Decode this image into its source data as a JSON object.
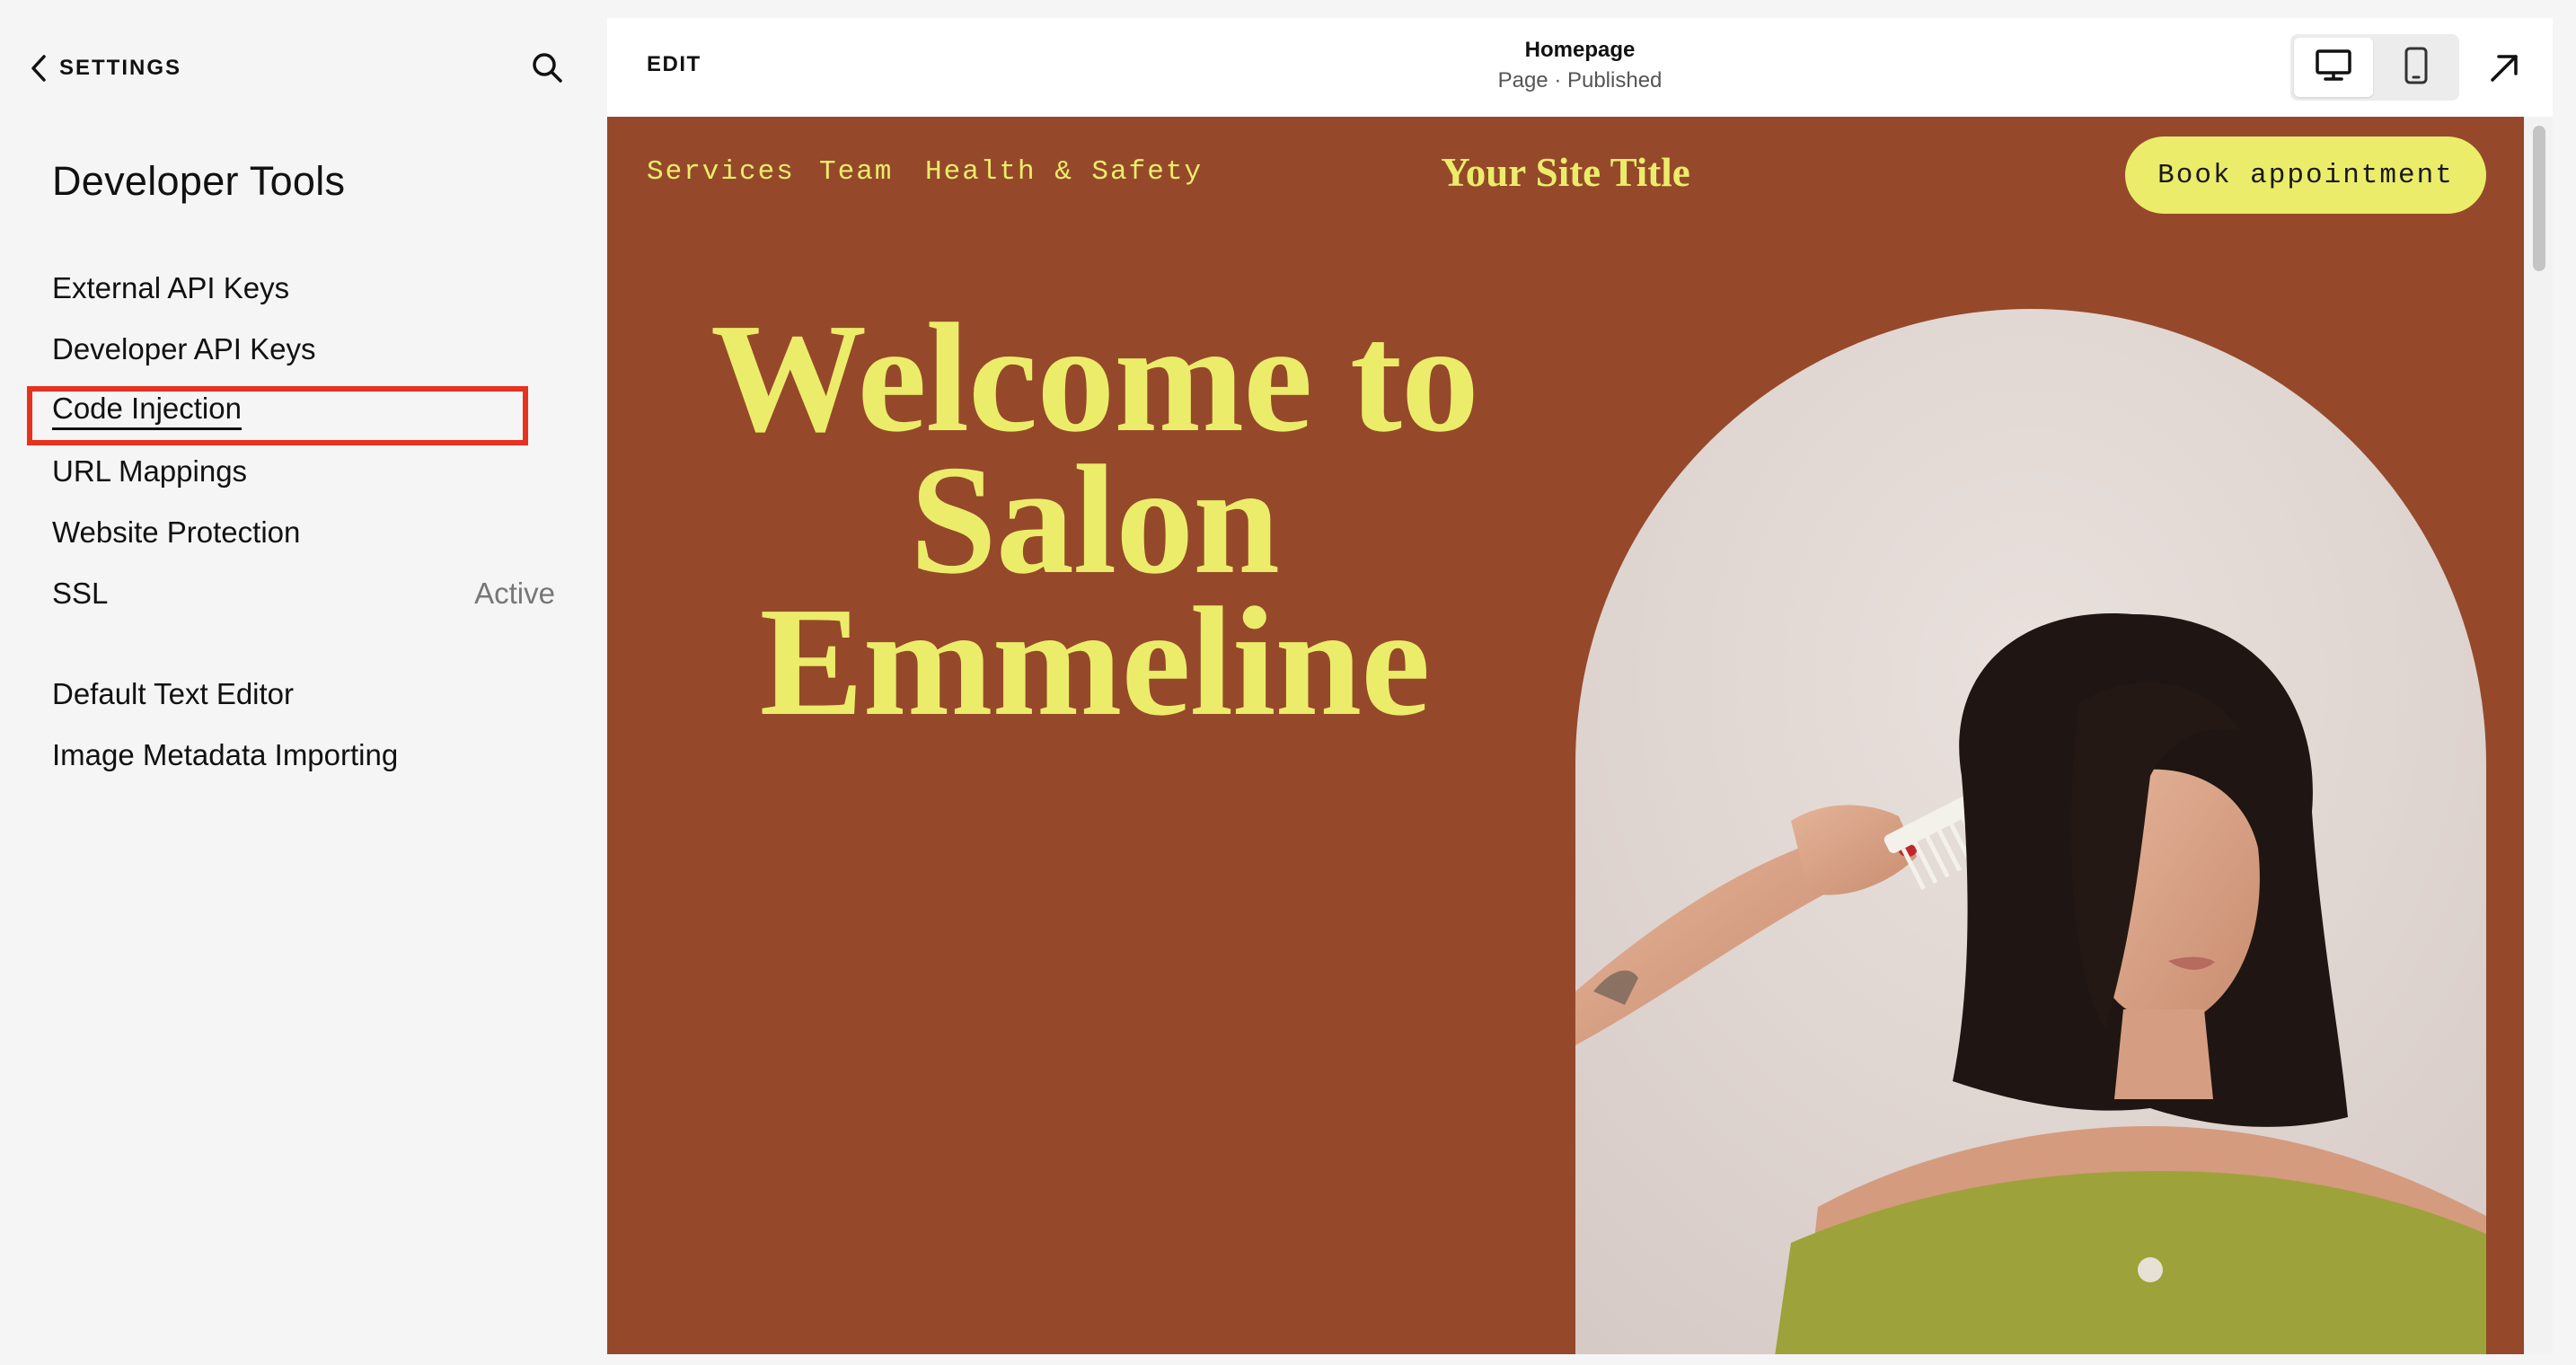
{
  "sidebar": {
    "back_label": "SETTINGS",
    "title": "Developer Tools",
    "items": [
      {
        "label": "External API Keys"
      },
      {
        "label": "Developer API Keys"
      },
      {
        "label": "Code Injection"
      },
      {
        "label": "URL Mappings"
      },
      {
        "label": "Website Protection"
      },
      {
        "label": "SSL",
        "status": "Active"
      },
      {
        "label": "Default Text Editor"
      },
      {
        "label": "Image Metadata Importing"
      }
    ]
  },
  "toolbar": {
    "edit_label": "EDIT",
    "page_name": "Homepage",
    "page_status": "Page · Published",
    "view_modes": [
      "desktop-icon",
      "mobile-icon"
    ],
    "active_view": "desktop"
  },
  "site": {
    "nav": [
      "Services",
      "Team",
      "Health & Safety"
    ],
    "title": "Your Site Title",
    "cta": "Book appointment",
    "headline": [
      "Welcome to",
      "Salon",
      "Emmeline"
    ],
    "colors": {
      "background": "#95492a",
      "accent": "#ecec6b"
    }
  },
  "colors": {
    "highlight": "#e6321e"
  }
}
